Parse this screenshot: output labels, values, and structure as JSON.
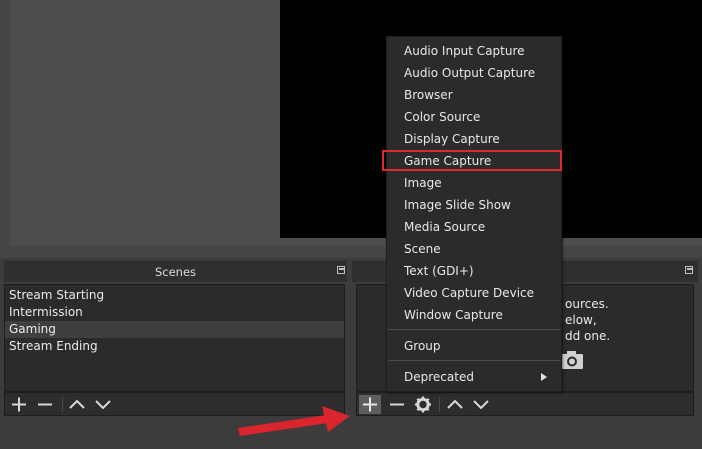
{
  "scenes": {
    "title": "Scenes",
    "items": [
      "Stream Starting",
      "Intermission",
      "Gaming",
      "Stream Ending"
    ],
    "selected_index": 2
  },
  "sources": {
    "hint_lines": [
      "ources.",
      "elow,",
      "dd one."
    ]
  },
  "context_menu": {
    "items": [
      "Audio Input Capture",
      "Audio Output Capture",
      "Browser",
      "Color Source",
      "Display Capture",
      "Game Capture",
      "Image",
      "Image Slide Show",
      "Media Source",
      "Scene",
      "Text (GDI+)",
      "Video Capture Device",
      "Window Capture"
    ],
    "group": "Group",
    "deprecated": "Deprecated",
    "highlighted_item": "Game Capture"
  },
  "icons": {
    "add": "plus-icon",
    "remove": "minus-icon",
    "up": "chevron-up-icon",
    "down": "chevron-down-icon",
    "properties": "gear-icon",
    "submenu": "chevron-right-icon",
    "camera": "camera-icon",
    "float": "undock-icon"
  },
  "colors": {
    "highlight_box": "#e0282e",
    "arrow": "#d9252b",
    "preview_canvas": "#000000"
  }
}
